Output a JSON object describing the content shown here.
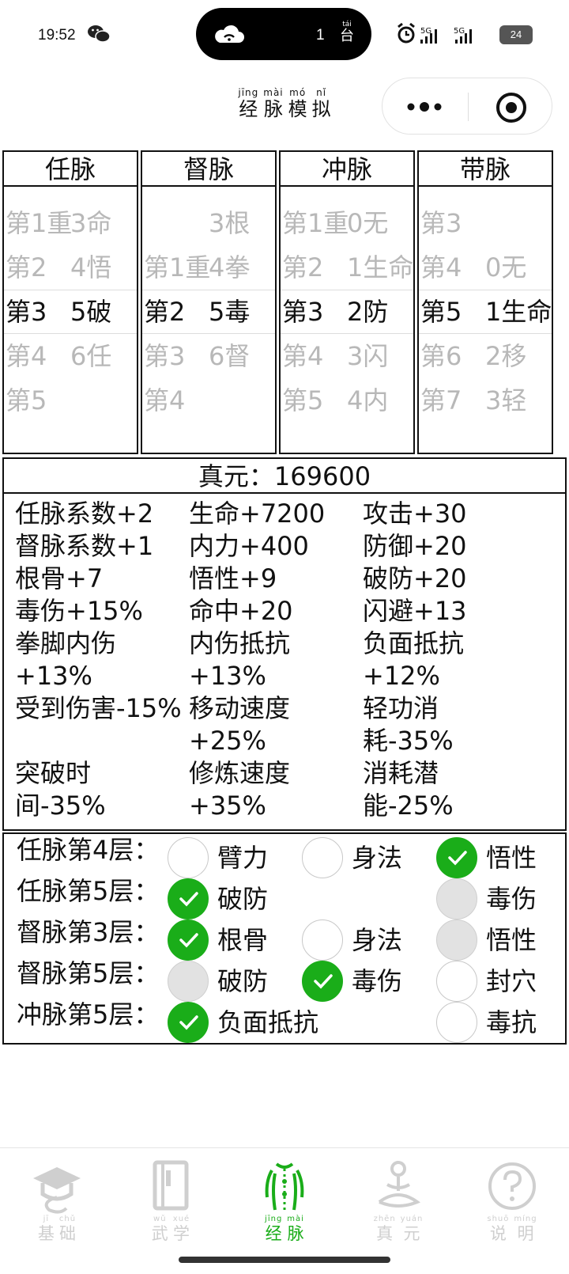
{
  "status": {
    "time": "19:52",
    "island_count": "1",
    "island_unit_pinyin": "tái",
    "island_unit": "台",
    "battery": "24",
    "net1": "5G",
    "net2": "5G"
  },
  "title": {
    "chars": [
      {
        "py": "jīng",
        "hz": "经"
      },
      {
        "py": "mài",
        "hz": "脉"
      },
      {
        "py": "mó",
        "hz": "模"
      },
      {
        "py": "nǐ",
        "hz": "拟"
      }
    ]
  },
  "meridians": [
    {
      "name": "任脉",
      "rows": [
        {
          "left": "第1重",
          "right": "3命",
          "state": "dim"
        },
        {
          "left": "第2",
          "right": "4悟",
          "state": "dim"
        },
        {
          "left": "第3",
          "right": "5破",
          "state": "sel"
        },
        {
          "left": "第4",
          "right": "6任",
          "state": "dim"
        },
        {
          "left": "第5",
          "right": "",
          "state": "dim"
        }
      ]
    },
    {
      "name": "督脉",
      "rows": [
        {
          "left": "",
          "right": "3根",
          "state": "dim"
        },
        {
          "left": "第1重",
          "right": "4拳",
          "state": "dim"
        },
        {
          "left": "第2",
          "right": "5毒",
          "state": "sel"
        },
        {
          "left": "第3",
          "right": "6督",
          "state": "dim"
        },
        {
          "left": "第4",
          "right": "",
          "state": "dim"
        }
      ]
    },
    {
      "name": "冲脉",
      "rows": [
        {
          "left": "第1重",
          "right": "0无",
          "state": "dim"
        },
        {
          "left": "第2",
          "right": "1生命",
          "state": "dim"
        },
        {
          "left": "第3",
          "right": "2防",
          "state": "sel"
        },
        {
          "left": "第4",
          "right": "3闪",
          "state": "dim"
        },
        {
          "left": "第5",
          "right": "4内",
          "state": "dim"
        }
      ]
    },
    {
      "name": "带脉",
      "rows": [
        {
          "left": "第3",
          "right": "",
          "state": "dim"
        },
        {
          "left": "第4",
          "right": "0无",
          "state": "dim"
        },
        {
          "left": "第5",
          "right": "1生命",
          "state": "sel"
        },
        {
          "left": "第6",
          "right": "2移",
          "state": "dim"
        },
        {
          "left": "第7",
          "right": "3轻",
          "state": "dim"
        }
      ]
    }
  ],
  "zhenyuan": "真元：169600",
  "stats": {
    "col1": [
      "任脉系数+2",
      "督脉系数+1",
      "根骨+7",
      "毒伤+15%",
      "拳脚内伤",
      "+13%",
      "受到伤害-15%",
      "",
      "突破时",
      "间-35%"
    ],
    "col2": [
      "生命+7200",
      "内力+400",
      "悟性+9",
      "命中+20",
      "内伤抵抗",
      "+13%",
      "移动速度",
      "+25%",
      "修炼速度",
      "+35%"
    ],
    "col3": [
      "攻击+30",
      "防御+20",
      "破防+20",
      "闪避+13",
      "负面抵抗",
      "+12%",
      "轻功消",
      "耗-35%",
      "消耗潜",
      "能-25%"
    ]
  },
  "options": [
    {
      "label": "任脉第4层：",
      "choices": [
        {
          "text": "臂力",
          "state": "unchecked"
        },
        {
          "text": "身法",
          "state": "unchecked"
        },
        {
          "text": "悟性",
          "state": "checked"
        }
      ]
    },
    {
      "label": "任脉第5层：",
      "choices": [
        {
          "text": "破防",
          "state": "checked"
        },
        null,
        {
          "text": "毒伤",
          "state": "disabled"
        }
      ]
    },
    {
      "label": "督脉第3层：",
      "choices": [
        {
          "text": "根骨",
          "state": "checked"
        },
        {
          "text": "身法",
          "state": "unchecked"
        },
        {
          "text": "悟性",
          "state": "disabled"
        }
      ]
    },
    {
      "label": "督脉第5层：",
      "choices": [
        {
          "text": "破防",
          "state": "disabled"
        },
        {
          "text": "毒伤",
          "state": "checked"
        },
        {
          "text": "封穴",
          "state": "unchecked"
        }
      ]
    },
    {
      "label": "冲脉第5层：",
      "choices": [
        {
          "text": "负面抵抗",
          "state": "checked"
        },
        null,
        {
          "text": "毒抗",
          "state": "unchecked"
        }
      ]
    }
  ],
  "tabs": [
    {
      "py": [
        "jī",
        "chǔ"
      ],
      "hz": [
        "基",
        "础"
      ],
      "icon": "scholar-cap-icon",
      "active": false
    },
    {
      "py": [
        "wǔ",
        "xué"
      ],
      "hz": [
        "武",
        "学"
      ],
      "icon": "book-icon",
      "active": false
    },
    {
      "py": [
        "jīng",
        "mài"
      ],
      "hz": [
        "经",
        "脉"
      ],
      "icon": "body-meridian-icon",
      "active": true
    },
    {
      "py": [
        "zhēn",
        "yuán"
      ],
      "hz": [
        "真",
        "元"
      ],
      "icon": "meditation-icon",
      "active": false
    },
    {
      "py": [
        "shuō",
        "míng"
      ],
      "hz": [
        "说",
        "明"
      ],
      "icon": "question-icon",
      "active": false
    }
  ],
  "colors": {
    "accent": "#1aad19",
    "disabled": "#e2e2e2",
    "text": "#111111"
  }
}
